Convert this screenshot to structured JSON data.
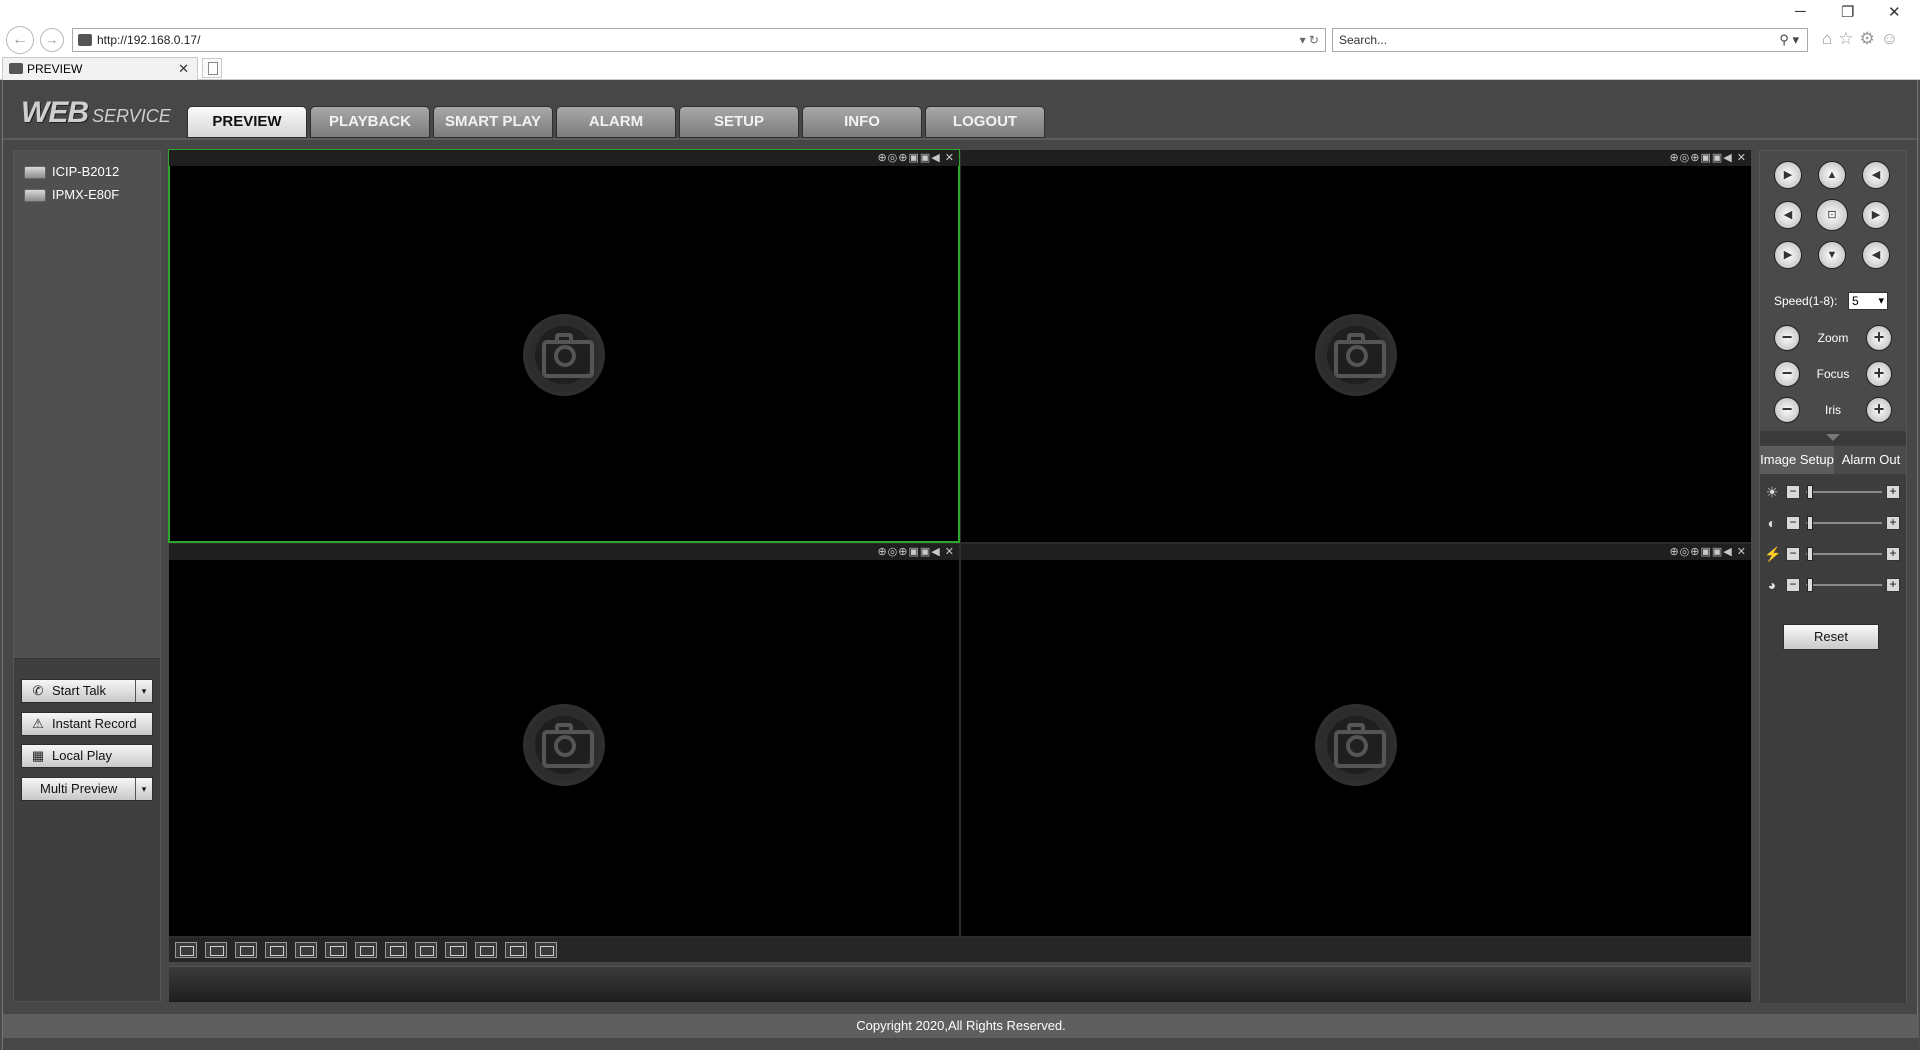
{
  "browser": {
    "url": "http://192.168.0.17/",
    "url_controls": "▾ ↻",
    "search_placeholder": "Search...",
    "search_controls": "⚲ ▾",
    "tab_title": "PREVIEW",
    "tab_close": "✕",
    "back_icon": "←",
    "forward_icon": "→",
    "right_icons": "⌂☆⚙☺",
    "window_minimize": "─",
    "window_restore": "❐",
    "window_close": "✕"
  },
  "app": {
    "logo_main": "WEB",
    "logo_sub": "SERVICE",
    "menu": [
      "PREVIEW",
      "PLAYBACK",
      "SMART PLAY",
      "ALARM",
      "SETUP",
      "INFO",
      "LOGOUT"
    ],
    "active_menu": "PREVIEW",
    "devices": [
      "ICIP-B2012",
      "IPMX-E80F"
    ],
    "left_buttons": {
      "start_talk": "Start Talk",
      "instant_record": "Instant Record",
      "local_play": "Local Play",
      "multi_preview": "Multi Preview"
    },
    "left_button_icons": {
      "start_talk": "✆",
      "instant_record": "⚠",
      "local_play": "▦"
    },
    "dropdown_arrow": "▾",
    "video_controls_glyphs": "⊕◎⊕▣▣◀ ✕",
    "ptz": {
      "speed_label": "Speed(1-8):",
      "speed_value": "5",
      "zoom_label": "Zoom",
      "focus_label": "Focus",
      "iris_label": "Iris",
      "minus": "−",
      "plus": "+",
      "arrows": {
        "up_left": "▶",
        "up": "▲",
        "up_right": "◀",
        "left": "◀",
        "center": "⊡",
        "right": "▶",
        "down_left": "▶",
        "down": "▼",
        "down_right": "◀"
      }
    },
    "right_tabs": [
      "Image Setup",
      "Alarm Out"
    ],
    "image_setup_icons": [
      "☀",
      "◐",
      "⚡",
      "◕"
    ],
    "image_setup_levels": [
      0.05,
      0.05,
      0.05,
      0.05
    ],
    "slider_minus": "−",
    "slider_plus": "+",
    "reset_label": "Reset",
    "footer": "Copyright 2020,All Rights Reserved."
  }
}
